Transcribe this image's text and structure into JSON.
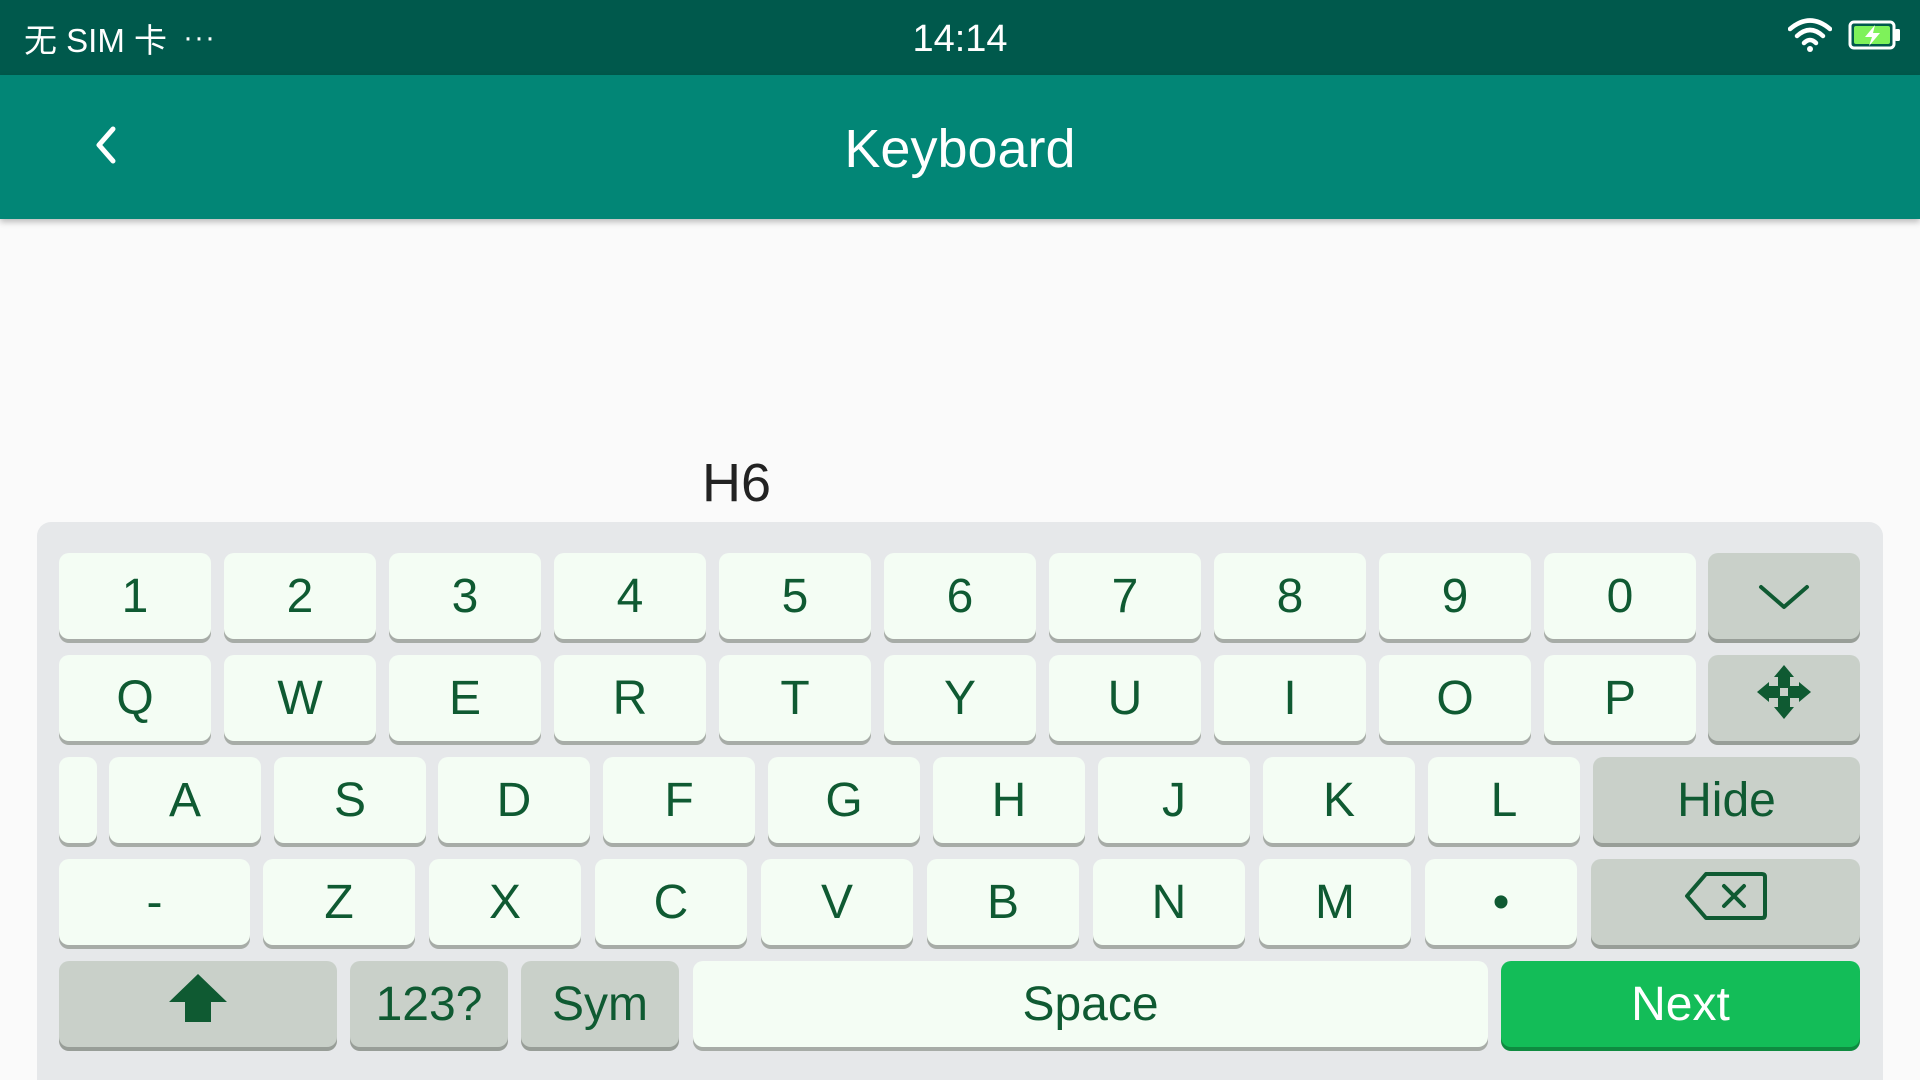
{
  "status_bar": {
    "carrier": "无 SIM 卡",
    "dots": "···",
    "time": "14:14",
    "battery_color": "#7ef25a"
  },
  "app_bar": {
    "title": "Keyboard",
    "background": "#028676",
    "back_icon": "chevron-left-icon"
  },
  "input": {
    "value": "H6",
    "underline_color": "#d81b60"
  },
  "keyboard": {
    "row1": [
      "1",
      "2",
      "3",
      "4",
      "5",
      "6",
      "7",
      "8",
      "9",
      "0"
    ],
    "row2": [
      "Q",
      "W",
      "E",
      "R",
      "T",
      "Y",
      "U",
      "I",
      "O",
      "P"
    ],
    "row3": [
      "A",
      "S",
      "D",
      "F",
      "G",
      "H",
      "J",
      "K",
      "L"
    ],
    "row4": [
      "-",
      "Z",
      "X",
      "C",
      "V",
      "B",
      "N",
      "M",
      "•"
    ],
    "hide_label": "Hide",
    "numbers_label": "123?",
    "sym_label": "Sym",
    "space_label": "Space",
    "next_label": "Next",
    "icons": {
      "collapse": "chevron-down-icon",
      "move": "move-arrows-icon",
      "backspace": "backspace-icon",
      "shift": "shift-arrow-icon"
    },
    "colors": {
      "key_bg": "#f4fdf4",
      "func_bg": "#c9d0c9",
      "text": "#0f5a32",
      "next_bg": "#13bd58"
    }
  }
}
